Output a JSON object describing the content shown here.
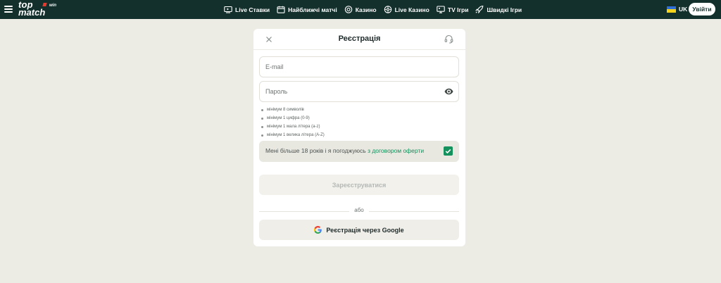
{
  "header": {
    "logo_top": "top",
    "logo_win": "win",
    "logo_bottom": "match",
    "nav": [
      {
        "label": "Live Ставки",
        "icon": "tv-live-icon"
      },
      {
        "label": "Найближчі матчі",
        "icon": "calendar-icon"
      },
      {
        "label": "Казино",
        "icon": "casino-chip-icon"
      },
      {
        "label": "Live Казино",
        "icon": "live-casino-chip-icon"
      },
      {
        "label": "TV Ігри",
        "icon": "tv-games-icon"
      },
      {
        "label": "Швидкі Ігри",
        "icon": "rocket-icon"
      }
    ],
    "language": "UK",
    "login_label": "Увійти"
  },
  "modal": {
    "title": "Реєстрація",
    "email_placeholder": "E-mail",
    "password_placeholder": "Пароль",
    "rules": [
      "мінімум 8 символів",
      "мінімум 1 цифра (0-9)",
      "мінімум 1 мала літера (a-z)",
      "мінімум 1 велика літера (A-Z)"
    ],
    "consent_text": "Мені більше 18 років і я погоджуюсь ",
    "consent_link": "з договором оферти",
    "consent_checked": true,
    "register_label": "Зареєструватися",
    "or_label": "або",
    "google_label": "Реєстрація через Google"
  },
  "colors": {
    "header_bg": "#13302c",
    "page_bg": "#ecece5",
    "accent_green": "#14915c",
    "flag_blue": "#2f6fd6",
    "flag_yellow": "#f5d21c"
  }
}
